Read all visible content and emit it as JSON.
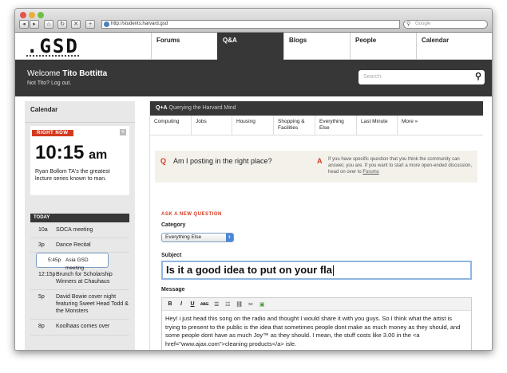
{
  "browser": {
    "url": "http://students.harvard.gsd",
    "search_placeholder": "Google",
    "colors": {
      "close": "#e8534a",
      "minimize": "#e7b03b",
      "maximize": "#6fc042"
    }
  },
  "site": {
    "logo": ".GSD",
    "nav": [
      "Forums",
      "Q&A",
      "Blogs",
      "People",
      "Calendar"
    ],
    "active_nav": "Q&A",
    "welcome_prefix": "Welcome ",
    "user_name": "Tito Bottitta",
    "logout_text": "Not Tito? Log out.",
    "search_placeholder": "Search."
  },
  "sidebar": {
    "title": "Calendar",
    "badge": "RIGHT NOW",
    "time": "10:15",
    "ampm": "am",
    "now_desc": "Ryan Bollom TA's the greatest lecture series known to man.",
    "today_label": "TODAY",
    "events": [
      {
        "time": "10a",
        "name": "SOCA meeting"
      },
      {
        "time": "3p",
        "name": "Dance Recital"
      },
      {
        "time": "5:45p",
        "name": "Asia GSD meeting"
      },
      {
        "time": "12:15p",
        "name": "Brunch for Scholarship Winners at Chauhaus"
      },
      {
        "time": "5p",
        "name": "David Bowie cover night featuring Sweet Head Todd & the Monsters"
      },
      {
        "time": "8p",
        "name": "Koolhaas comes over"
      }
    ]
  },
  "main": {
    "header_prefix": "Q+A",
    "header_text": " Querying the Harvard Mind",
    "categories": [
      "Computing",
      "Jobs",
      "Housing",
      "Shopping & Facilities",
      "Everything Else",
      "Last Minute",
      "More »"
    ],
    "question_letter": "Q",
    "question": "Am I posting in the right place?",
    "answer_letter": "A",
    "answer_text": "If you have specific question that you think the community can answer, you are. If you want to start a more open-ended discussion, head on over to ",
    "answer_link": "Forums",
    "form": {
      "title": "ASK A NEW QUESTION",
      "category_label": "Category",
      "category_value": "Everything Else",
      "subject_label": "Subject",
      "subject_value": "Is it a good idea to put on your fla",
      "message_label": "Message",
      "toolbar": [
        "B",
        "I",
        "U",
        "ABC",
        "☰",
        "☷",
        "⛓",
        "✂",
        "▣"
      ],
      "message_text": "Hey! i just head this song on the radio and thought I would share it with you guys. So I think what the artist is trying to present to the public is the idea that sometimes people dont make as much money as they should, and some people dont have as much Joy™ as they should. I mean, the stuff costs like 3.00 in the <a href=\"www.ajax.com\">cleaning products</a> isle."
    }
  }
}
